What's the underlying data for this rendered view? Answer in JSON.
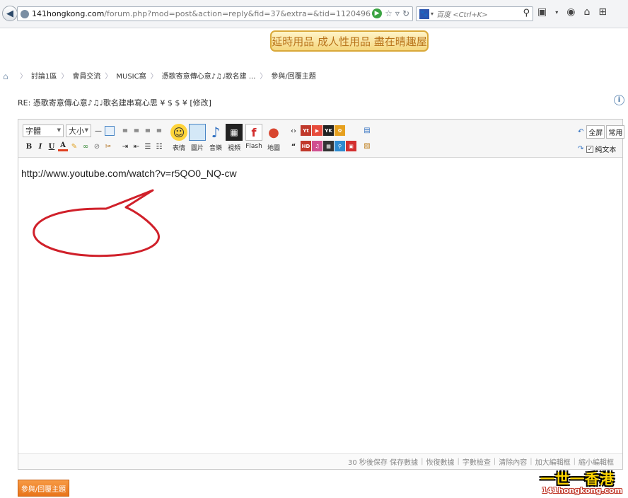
{
  "browser": {
    "url_host": "141hongkong.com",
    "url_path": "/forum.php?mod=post&action=reply&fid=37&extra=&tid=1120496",
    "search_placeholder": "百度 <Ctrl+K>"
  },
  "banner": {
    "text": "延時用品 成人性用品 盡在晴趣屋"
  },
  "breadcrumb": {
    "items": [
      "討論1區",
      "會員交流",
      "MUSIC窩",
      "憑歌寄意傳心意♪♫♩歌名建 ...",
      "參與/回覆主題"
    ]
  },
  "reply_title": "RE: 憑歌寄意傳心意♪♫♩歌名建串寫心思 ¥ $ $ ¥ [修改]",
  "editor": {
    "font_select": "字體",
    "size_select": "大小",
    "tools": {
      "emoticon": "表情",
      "image": "圖片",
      "music": "音樂",
      "video": "視頻",
      "flash": "Flash",
      "map": "地圖"
    },
    "right": {
      "fullscreen": "全屏",
      "common": "常用",
      "plaintext": "純文本"
    },
    "content": "http://www.youtube.com/watch?v=r5QO0_NQ-cw",
    "footer": [
      "30 秒後保存 保存數據",
      "恢復數據",
      "字數檢查",
      "清除內容",
      "加大編輯框",
      "縮小編輯框"
    ]
  },
  "submit_label": "參與/回覆主題",
  "watermark": {
    "main": "一世一香港",
    "sub": "141hongkong.com"
  }
}
